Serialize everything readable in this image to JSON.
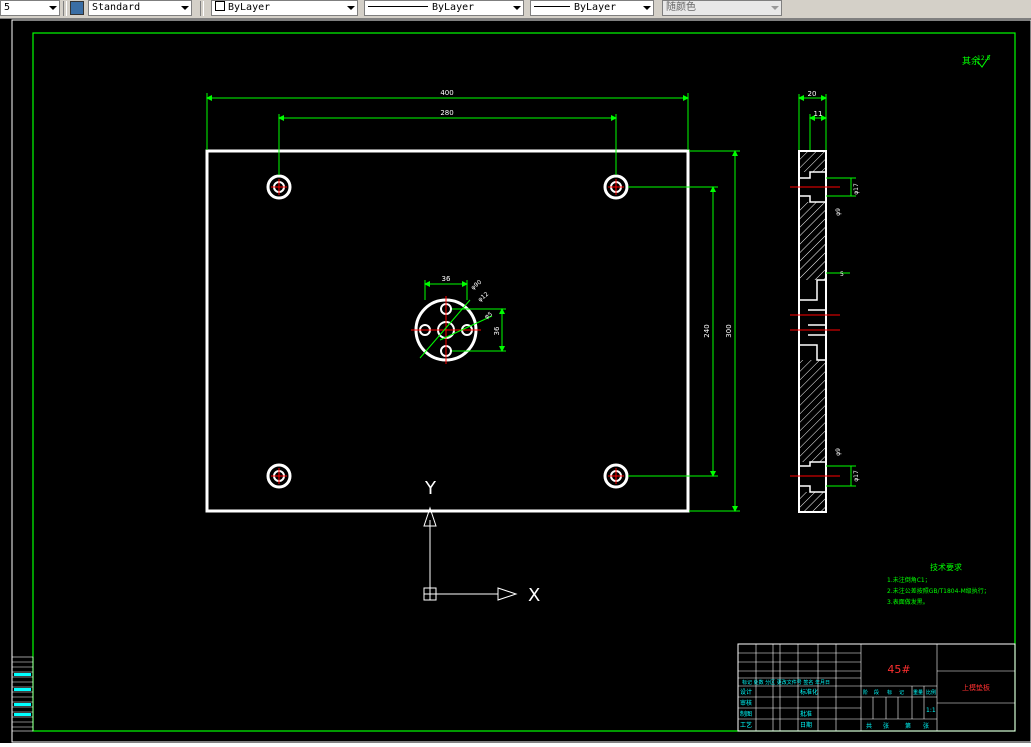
{
  "toolbar": {
    "layer_fragment": "5",
    "text_style": "Standard",
    "layer": "ByLayer",
    "linetype": "ByLayer",
    "lineweight": "ByLayer",
    "color": "随颜色"
  },
  "drawing": {
    "roughness_note": "其余",
    "roughness_value": "12.5",
    "dims_front": {
      "overall_width": "400",
      "hole_spacing_x": "280",
      "hole_spacing_y": "240",
      "overall_height": "300",
      "center_offset": "36",
      "center_offset_v": "36",
      "dia_outer": "φ90",
      "dia_pitch": "φ12",
      "dia_inner": "φ5"
    },
    "dims_side": {
      "thickness": "20",
      "step": "11",
      "dia_cbore_top": "φ17",
      "dia_hole_top": "φ9",
      "recess": "5",
      "dia_hole_bottom": "φ9",
      "dia_cbore_bottom": "φ17"
    },
    "ucs": {
      "y_label": "Y",
      "x_label": "X"
    },
    "tech_requirements": {
      "title": "技术要求",
      "lines": [
        "1.未注倒角C1；",
        "2.未注公差按照GB/T1804-M级执行；",
        "3.表面做发黑。"
      ]
    },
    "title_block": {
      "material": "45#",
      "part_name": "上模垫板",
      "scale": "1:1",
      "row_labels": [
        "设计",
        "审核",
        "制图",
        "工艺"
      ],
      "mid_labels": [
        "标准化",
        "批准",
        "日期"
      ],
      "header_row": "标记 处数 分区 更改文件号 签名 年月日",
      "weight_headers": [
        "阶",
        "段",
        "标",
        "记",
        "重量",
        "比例"
      ],
      "sheet_labels": [
        "共",
        "张",
        "第",
        "张"
      ]
    }
  },
  "colors": {
    "accent": "#00ff00",
    "dim": "#00ff00",
    "outline": "#ffffff",
    "center": "#ff0000",
    "text_cyan": "#00ffff",
    "title_red": "#ff3030",
    "bg": "#000000"
  }
}
